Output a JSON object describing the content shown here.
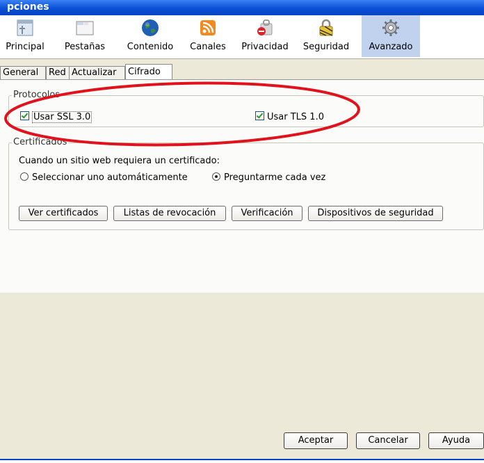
{
  "window": {
    "title": "pciones"
  },
  "toolbar": {
    "panes": [
      {
        "label": "Principal",
        "icon": "window-icon"
      },
      {
        "label": "Pestañas",
        "icon": "tabs-icon"
      },
      {
        "label": "Contenido",
        "icon": "globe-icon"
      },
      {
        "label": "Canales",
        "icon": "rss-icon"
      },
      {
        "label": "Privacidad",
        "icon": "privacy-icon"
      },
      {
        "label": "Seguridad",
        "icon": "lock-icon"
      },
      {
        "label": "Avanzado",
        "icon": "gear-icon"
      }
    ],
    "selected": "Avanzado"
  },
  "tabs": [
    "General",
    "Red",
    "Actualizar",
    "Cifrado"
  ],
  "active_tab": "Cifrado",
  "protocols": {
    "legend": "Protocolos",
    "ssl_label": "Usar SSL 3.0",
    "ssl_checked": true,
    "tls_label": "Usar TLS 1.0",
    "tls_checked": true
  },
  "certificates": {
    "legend": "Certificados",
    "prompt": "Cuando un sitio web requiera un certificado:",
    "option_auto": "Seleccionar uno automáticamente",
    "option_ask": "Preguntarme cada vez",
    "selected_option": "Preguntarme cada vez",
    "buttons": [
      "Ver certificados",
      "Listas de revocación",
      "Verificación",
      "Dispositivos de seguridad"
    ]
  },
  "footer": {
    "ok": "Aceptar",
    "cancel": "Cancelar",
    "help": "Ayuda"
  },
  "colors": {
    "annotation": "#e0121b",
    "selected_pane": "#c1d2ee",
    "title_bar": "#0a4fd6"
  }
}
